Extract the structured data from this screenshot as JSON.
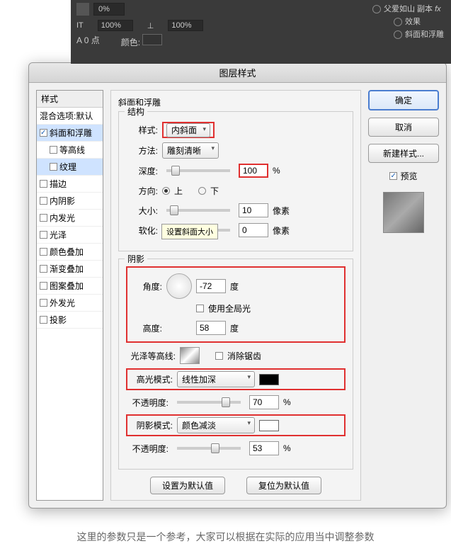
{
  "topbar": {
    "pct1": "0%",
    "pct2a": "100%",
    "pct2b": "100%",
    "pt_label": "0 点",
    "color_label": "颜色:",
    "layer_name": "父爱如山 副本",
    "fx": "fx",
    "fx_effects": "效果",
    "fx_bevel": "斜面和浮雕"
  },
  "dialog": {
    "title": "图层样式",
    "styles_header": "样式",
    "blend_defaults": "混合选项:默认",
    "items": [
      {
        "label": "斜面和浮雕",
        "checked": true,
        "sel": true
      },
      {
        "label": "等高线",
        "checked": false,
        "indent": true
      },
      {
        "label": "纹理",
        "checked": false,
        "indent": true,
        "sel": true
      },
      {
        "label": "描边",
        "checked": false
      },
      {
        "label": "内阴影",
        "checked": false
      },
      {
        "label": "内发光",
        "checked": false
      },
      {
        "label": "光泽",
        "checked": false
      },
      {
        "label": "颜色叠加",
        "checked": false
      },
      {
        "label": "渐变叠加",
        "checked": false
      },
      {
        "label": "图案叠加",
        "checked": false
      },
      {
        "label": "外发光",
        "checked": false
      },
      {
        "label": "投影",
        "checked": false
      }
    ],
    "panel_title": "斜面和浮雕",
    "group_struct": "结构",
    "style_label": "样式:",
    "style_value": "内斜面",
    "method_label": "方法:",
    "method_value": "雕刻清晰",
    "depth_label": "深度:",
    "depth_value": "100",
    "pct": "%",
    "dir_label": "方向:",
    "dir_up": "上",
    "dir_down": "下",
    "size_label": "大小:",
    "size_value": "10",
    "px": "像素",
    "soften_label": "软化:",
    "soften_value": "0",
    "tooltip": "设置斜面大小",
    "group_shade": "阴影",
    "angle_label": "角度:",
    "angle_value": "-72",
    "deg": "度",
    "global_light": "使用全局光",
    "alt_label": "高度:",
    "alt_value": "58",
    "gloss_label": "光泽等高线:",
    "antialias": "消除锯齿",
    "hl_mode_label": "高光模式:",
    "hl_mode_value": "线性加深",
    "hl_opacity_label": "不透明度:",
    "hl_opacity_value": "70",
    "sh_mode_label": "阴影模式:",
    "sh_mode_value": "颜色减淡",
    "sh_opacity_label": "不透明度:",
    "sh_opacity_value": "53",
    "set_default": "设置为默认值",
    "reset_default": "复位为默认值",
    "ok": "确定",
    "cancel": "取消",
    "new_style": "新建样式...",
    "preview": "预览"
  },
  "caption": "这里的参数只是一个参考，大家可以根据在实际的应用当中调整参数"
}
